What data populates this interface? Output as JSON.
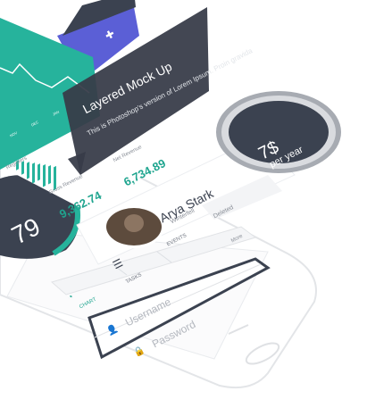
{
  "mockup": {
    "title": "Layered Mock Up",
    "description": "This is Photoshop's version of Lorem Ipsum. Proin gravida"
  },
  "price": {
    "amount": "7$",
    "period": "per year"
  },
  "stats": {
    "gross_revenue_label": "Gross Revenue",
    "gross_revenue_value": "9,362.74",
    "net_revenue_label": "Net Revenue",
    "net_revenue_value": "6,734.89",
    "registers_label": "Registers"
  },
  "chart_axis": [
    "NOV",
    "DEC",
    "JAN"
  ],
  "profile": {
    "name": "Arya Stark",
    "subtitle": "Winterfell",
    "deleted_label": "Deleted",
    "more_label": "More"
  },
  "big_number": "79",
  "tabs": {
    "chart": "CHART",
    "tasks": "TASKS",
    "events": "EVENTS"
  },
  "login": {
    "username_placeholder": "Username",
    "password_placeholder": "Password"
  },
  "colors": {
    "teal": "#26b39c",
    "dark": "#3b4250",
    "accent_purple": "#5b5fd6"
  },
  "icons": {
    "plus": "plus-icon",
    "user": "user-icon",
    "lock": "lock-icon",
    "tasks": "list-icon",
    "chart": "pie-chart-icon"
  }
}
